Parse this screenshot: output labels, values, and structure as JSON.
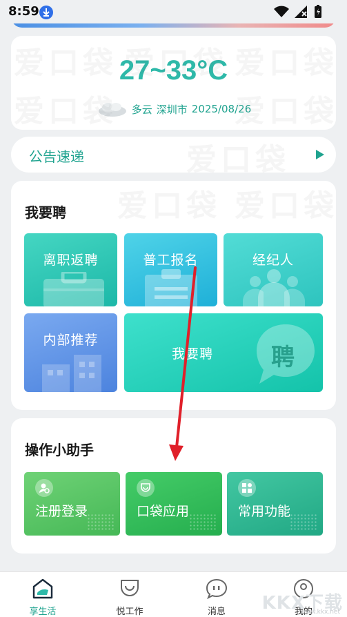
{
  "status_bar": {
    "time": "8:59"
  },
  "weather": {
    "temperature": "27~33°C",
    "condition": "多云",
    "city": "深圳市",
    "date": "2025/08/26"
  },
  "notice": {
    "label": "公告速递"
  },
  "recruit": {
    "title": "我要聘",
    "tiles": [
      {
        "label": "离职返聘",
        "icon": "briefcase-icon"
      },
      {
        "label": "普工报名",
        "icon": "clipboard-icon"
      },
      {
        "label": "经纪人",
        "icon": "people-icon"
      },
      {
        "label": "内部推荐",
        "icon": "buildings-icon"
      },
      {
        "label": "我要聘",
        "icon": "pin-badge-icon",
        "badge": "聘"
      }
    ]
  },
  "helper": {
    "title": "操作小助手",
    "tiles": [
      {
        "label": "注册登录",
        "icon": "user-add-icon"
      },
      {
        "label": "口袋应用",
        "icon": "pocket-icon"
      },
      {
        "label": "常用功能",
        "icon": "grid-icon"
      }
    ]
  },
  "bottom_nav": [
    {
      "label": "享生活",
      "icon": "home-icon",
      "active": true
    },
    {
      "label": "悦工作",
      "icon": "pocket-nav-icon",
      "active": false
    },
    {
      "label": "消息",
      "icon": "chat-icon",
      "active": false
    },
    {
      "label": "我的",
      "icon": "profile-icon",
      "active": false
    }
  ],
  "watermark": "爱口袋",
  "corner_logo": {
    "text": "KKX下载",
    "url": "www.kkx.net"
  },
  "colors": {
    "accent": "#1fa38f",
    "temperature": "#2eb9a9",
    "annotation_arrow": "#e0202a"
  }
}
